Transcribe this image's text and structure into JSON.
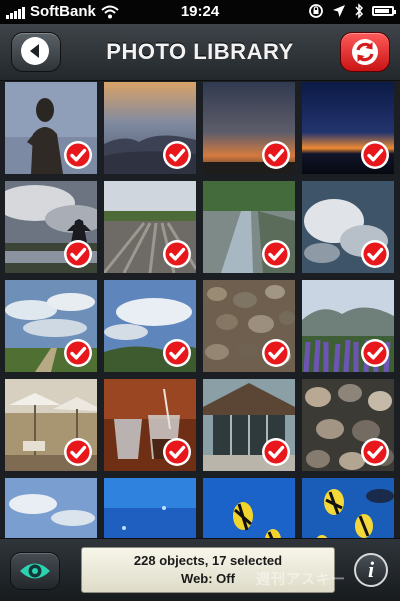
{
  "status_bar": {
    "carrier": "SoftBank",
    "time": "19:24"
  },
  "nav": {
    "title": "PHOTO LIBRARY",
    "back_icon": "back-arrow-icon",
    "refresh_icon": "refresh-icon"
  },
  "grid": {
    "thumbnails": [
      {
        "scene": "statue",
        "selected": true
      },
      {
        "scene": "sunset-mountains",
        "selected": true
      },
      {
        "scene": "dusk-sky",
        "selected": true
      },
      {
        "scene": "night-horizon",
        "selected": true
      },
      {
        "scene": "castle-clouds",
        "selected": true
      },
      {
        "scene": "field-rows",
        "selected": true
      },
      {
        "scene": "water-channel",
        "selected": true
      },
      {
        "scene": "cloud-reflection",
        "selected": true
      },
      {
        "scene": "sky-lawn",
        "selected": true
      },
      {
        "scene": "sky-hills",
        "selected": true
      },
      {
        "scene": "pebbles",
        "selected": true
      },
      {
        "scene": "lavender-mountains",
        "selected": true
      },
      {
        "scene": "patio-umbrellas",
        "selected": true
      },
      {
        "scene": "glasses",
        "selected": true
      },
      {
        "scene": "building-entrance",
        "selected": true
      },
      {
        "scene": "stones",
        "selected": true
      },
      {
        "scene": "sky-landscape",
        "selected": false
      },
      {
        "scene": "aquarium",
        "selected": false
      },
      {
        "scene": "aquarium-fish",
        "selected": false
      },
      {
        "scene": "aquarium-fish2",
        "selected": false
      }
    ]
  },
  "bottom_bar": {
    "status_line1": "228 objects, 17 selected",
    "status_line2": "Web: Off",
    "eye_icon": "eye-icon",
    "info_label": "i",
    "watermark": "週刊アスキー"
  },
  "colors": {
    "check_red": "#e8171c",
    "refresh_red": "#e02525",
    "eye_teal": "#2dd3b0",
    "panel_bg": "#f2f0e2"
  }
}
